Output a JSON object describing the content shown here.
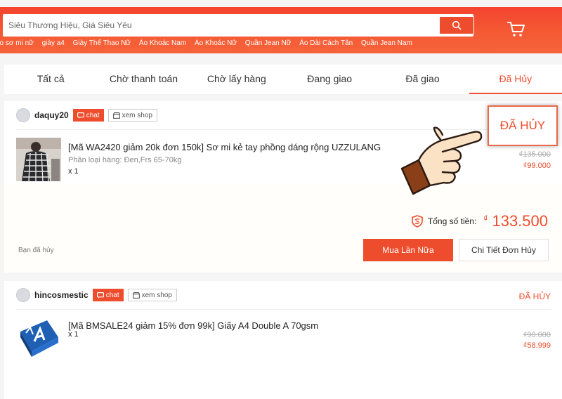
{
  "search": {
    "placeholder": "Siêu Thương Hiệu, Giá Siêu Yêu"
  },
  "keywords": [
    "áo sơ mi nữ",
    "giày a4",
    "Giày Thể Thao Nữ",
    "Áo Khoác Nam",
    "Áo Khoác Nữ",
    "Quần Jean Nữ",
    "Áo Dài Cách Tân",
    "Quần Jean Nam"
  ],
  "tabs": [
    {
      "label": "Tất cả"
    },
    {
      "label": "Chờ thanh toán"
    },
    {
      "label": "Chờ lấy hàng"
    },
    {
      "label": "Đang giao"
    },
    {
      "label": "Đã giao"
    },
    {
      "label": "Đã Hủy"
    }
  ],
  "buttons": {
    "chat": "chat",
    "view_shop": "xem shop"
  },
  "orders": [
    {
      "shop": "daquy20",
      "status": "ĐÃ HỦY",
      "product": {
        "title": "[Mã WA2420 giảm 20k đơn 150k] Sơ mi kẻ tay phồng dáng rộng UZZULANG",
        "variant": "Phân loại hàng: Đen,Frs 65-70kg",
        "qty": "x 1",
        "old_price": "₫135.000",
        "new_price": "₫99.000"
      },
      "total_label": "Tổng số tiền:",
      "total_currency": "₫",
      "total_value": "133.500",
      "cancel_note": "Bạn đã hủy",
      "rebuy_label": "Mua Lần Nữa",
      "detail_label": "Chi Tiết Đơn Hủy"
    },
    {
      "shop": "hincosmestic",
      "status": "ĐÃ HỦY",
      "product": {
        "title": "[Mã BMSALE24 giảm 15% đơn 99k] Giấy A4 Double A 70gsm",
        "qty": "x 1",
        "old_price": "₫90.000",
        "new_price": "₫58.999"
      }
    }
  ],
  "colors": {
    "brand": "#ee4d2d",
    "header": "#f53d2d"
  },
  "icons": {
    "search": "search-icon",
    "cart": "cart-icon",
    "chat": "chat-icon",
    "shop": "shop-icon",
    "pointer": "hand-pointer-icon",
    "guard": "shield-icon"
  }
}
